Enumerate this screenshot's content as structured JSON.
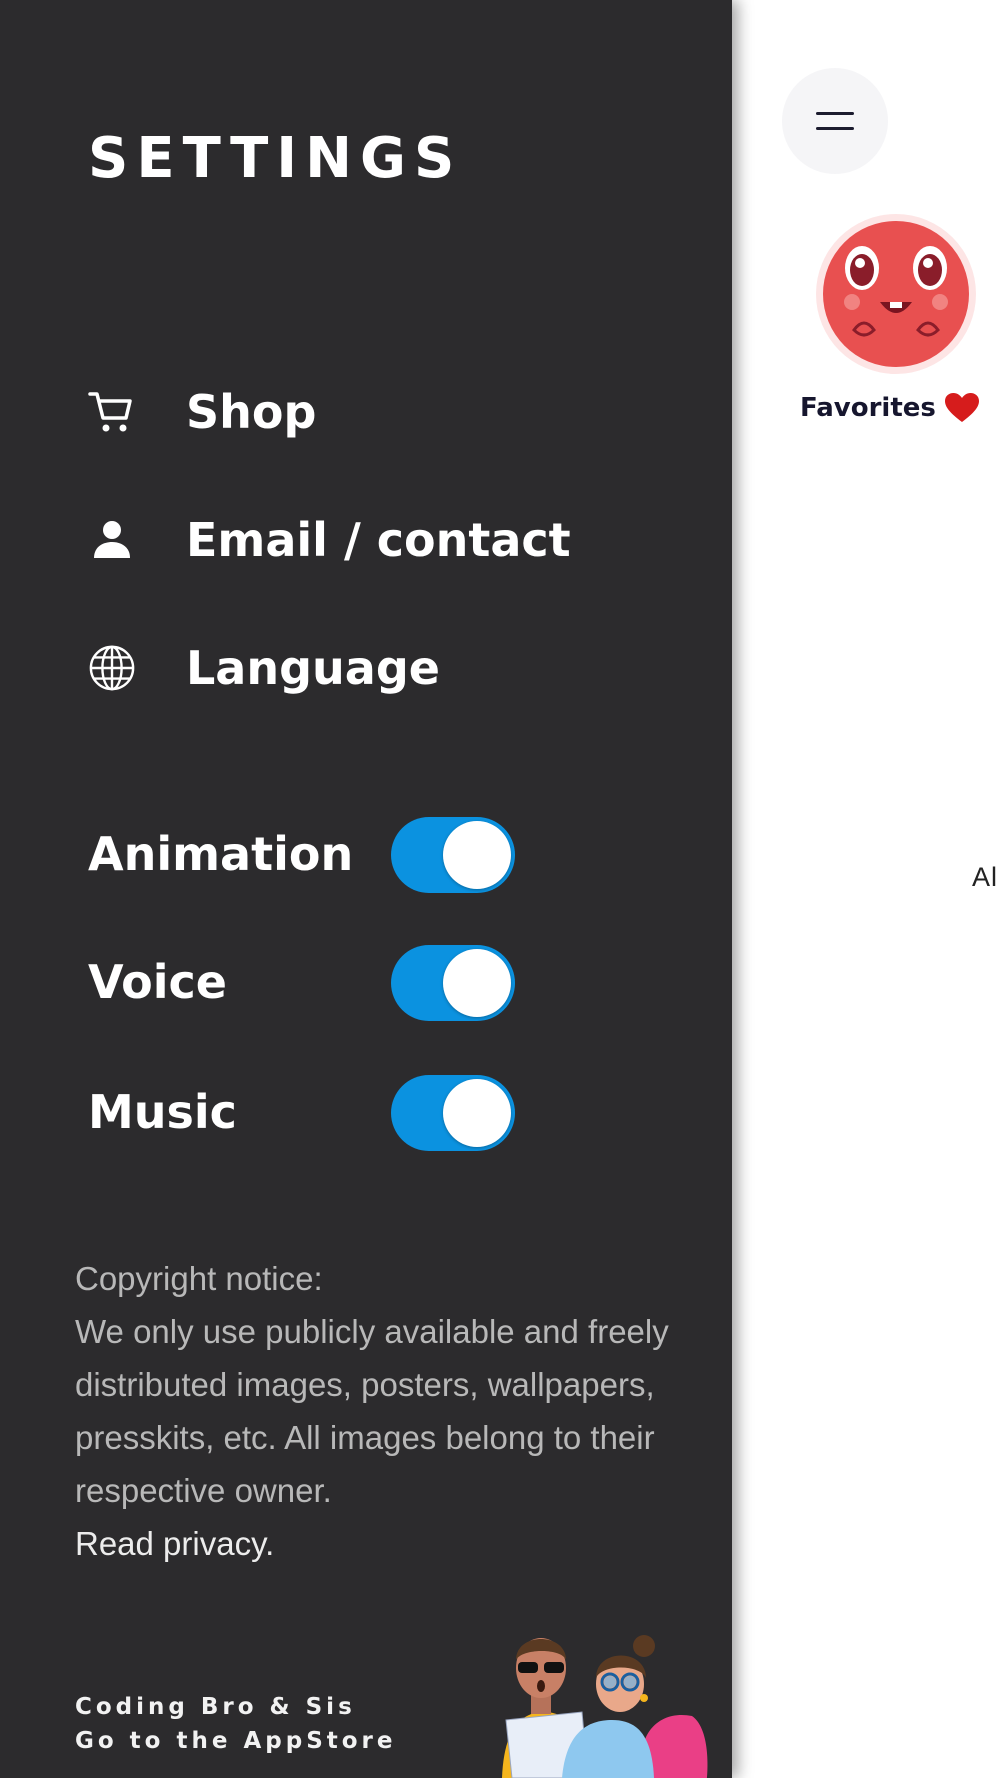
{
  "drawer": {
    "title": "SETTINGS",
    "menu": [
      {
        "label": "Shop",
        "icon": "cart-icon"
      },
      {
        "label": "Email / contact",
        "icon": "person-icon"
      },
      {
        "label": "Language",
        "icon": "globe-icon"
      }
    ],
    "toggles": [
      {
        "label": "Animation",
        "on": true
      },
      {
        "label": "Voice",
        "on": true
      },
      {
        "label": "Music",
        "on": true
      }
    ],
    "toggle_color": "#0b92e0",
    "background": "#2c2b2d",
    "copyright": {
      "heading": "Copyright notice:",
      "body": "We only use publicly available and freely distributed images, posters, wallpapers, presskits, etc. All images belong to their respective owner.",
      "privacy_link": "Read privacy."
    },
    "developer": {
      "name": "Coding Bro & Sis",
      "store_link": "Go to the AppStore"
    }
  },
  "main": {
    "favorites_label": "Favorites",
    "edge_text": "Al"
  }
}
